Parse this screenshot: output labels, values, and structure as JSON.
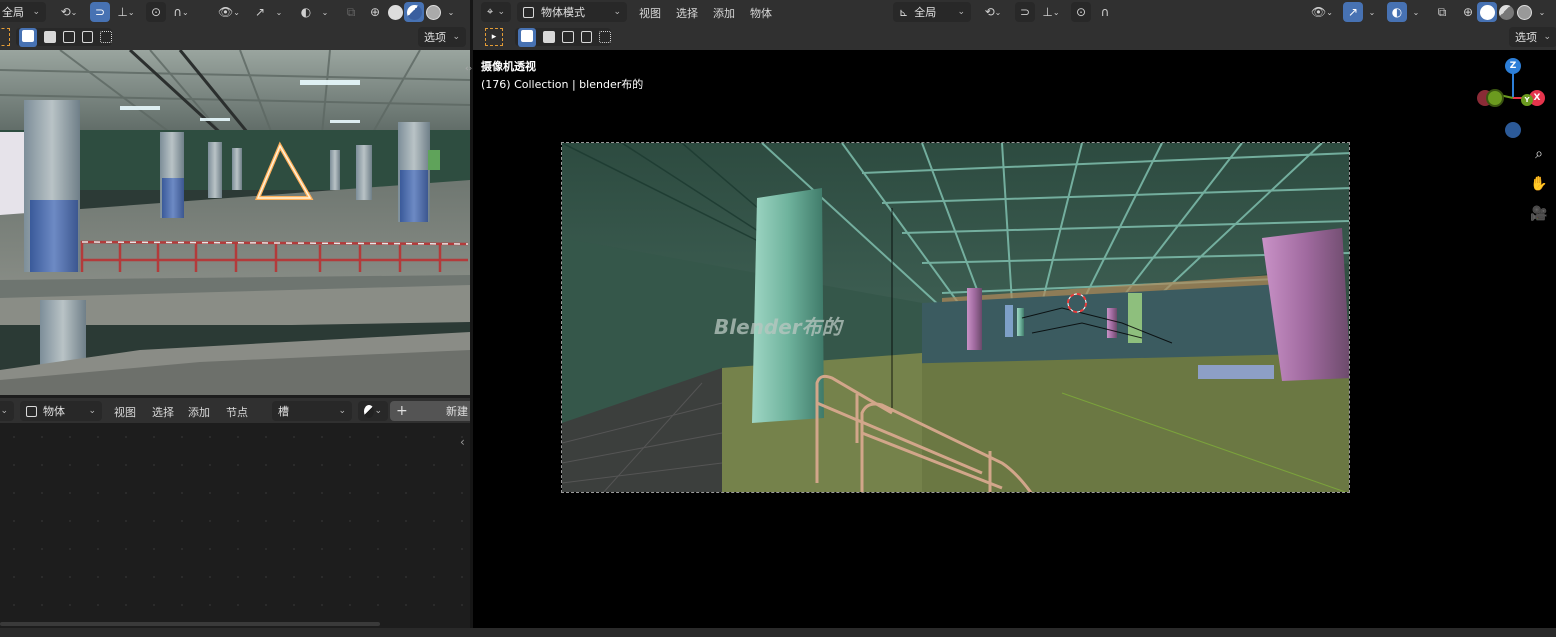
{
  "left_viewport": {
    "transform_orientation": "全局",
    "options_label": "选项"
  },
  "node_editor": {
    "object_type": "物体",
    "menus": [
      "视图",
      "选择",
      "添加",
      "节点"
    ],
    "slot_label": "槽",
    "new_label": "新建"
  },
  "right_viewport": {
    "mode_label": "物体模式",
    "menus": [
      "视图",
      "选择",
      "添加",
      "物体"
    ],
    "transform_orientation": "全局",
    "options_label": "选项",
    "view_name": "摄像机透视",
    "view_info": "(176) Collection | blender布的",
    "watermark": "Blender布的"
  },
  "gizmo": {
    "z_label": "Z",
    "y_label": "Y",
    "x_label": "X"
  },
  "colors": {
    "accent": "#4772b3",
    "header_bg": "#303030",
    "viewport_bg": "#000000",
    "x_axis": "#e5344c",
    "y_axis": "#6b9a1f",
    "z_axis": "#2d7fd8"
  }
}
